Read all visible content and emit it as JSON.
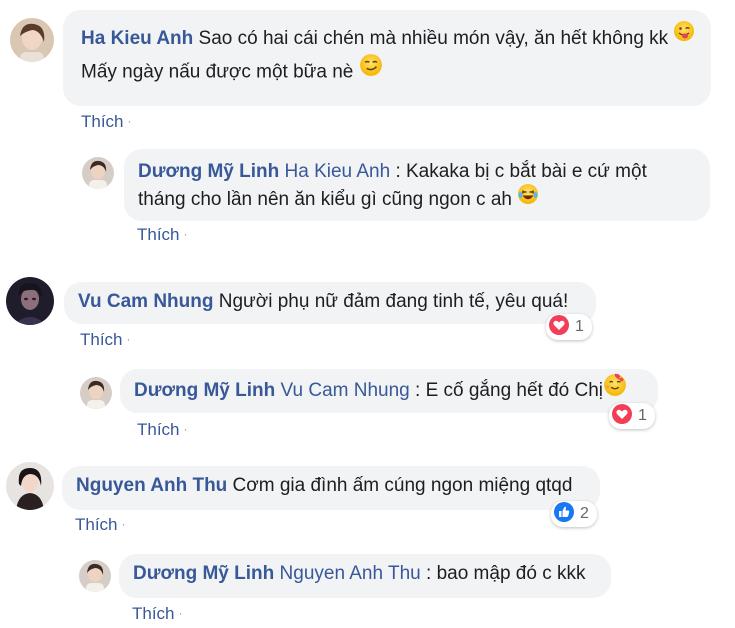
{
  "colors": {
    "link": "#385898",
    "bubble": "#f2f3f5",
    "love": "#f33e58",
    "like": "#1877f2"
  },
  "comments": [
    {
      "author": "Ha Kieu Anh",
      "text_line1": " Sao có hai cái chén mà nhiều món vậy, ăn hết không kk",
      "text_line2": "Mấy ngày nấu được một bữa nè ",
      "emojis": [
        "tongue-wink-emoji",
        "smirk-emoji"
      ],
      "action": "Thích",
      "reply": {
        "author": "Dương Mỹ Linh",
        "mention": " Ha Kieu Anh",
        "text_line1": " : Kakaka bị c bắt bài e cứ một",
        "text_line2": "tháng cho lần nên ăn kiểu gì cũng ngon c ah ",
        "emoji": "laugh-tears-emoji",
        "action": "Thích"
      }
    },
    {
      "author": "Vu Cam Nhung",
      "text": " Người phụ nữ đảm đang tinh tế, yêu quá!",
      "reaction": {
        "type": "love",
        "count": "1"
      },
      "action": "Thích",
      "reply": {
        "author": "Dương Mỹ Linh",
        "mention": " Vu Cam Nhung",
        "text": " : E cố gắng hết đó Chị",
        "emoji": "heart-eyes-hug-emoji",
        "reaction": {
          "type": "love",
          "count": "1"
        },
        "action": "Thích"
      }
    },
    {
      "author": "Nguyen Anh Thu",
      "text": " Cơm gia đình ấm cúng ngon miệng qtqd",
      "reaction": {
        "type": "like",
        "count": "2"
      },
      "action": "Thích",
      "reply": {
        "author": "Dương Mỹ Linh",
        "mention": " Nguyen Anh Thu",
        "text": " : bao mập đó c kkk",
        "action": "Thích"
      }
    }
  ],
  "separator": "·"
}
